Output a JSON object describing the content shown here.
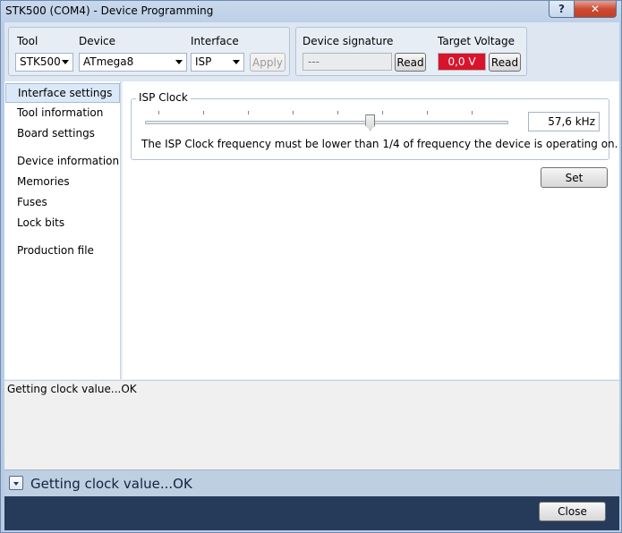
{
  "window": {
    "title": "STK500 (COM4) - Device Programming",
    "help_glyph": "?",
    "close_glyph": "✕"
  },
  "tool_group": {
    "tool_label": "Tool",
    "tool_value": "STK500",
    "device_label": "Device",
    "device_value": "ATmega8",
    "interface_label": "Interface",
    "interface_value": "ISP",
    "apply_label": "Apply"
  },
  "signature_group": {
    "signature_label": "Device signature",
    "signature_value": "---",
    "read_label": "Read",
    "voltage_label": "Target Voltage",
    "voltage_value": "0,0 V",
    "voltage_read_label": "Read",
    "voltage_color": "#d7142b"
  },
  "sidebar": {
    "items": [
      {
        "label": "Interface settings",
        "active": true
      },
      {
        "label": "Tool information"
      },
      {
        "label": "Board settings"
      },
      {
        "label": "Device information"
      },
      {
        "label": "Memories"
      },
      {
        "label": "Fuses"
      },
      {
        "label": "Lock bits"
      },
      {
        "label": "Production file"
      }
    ]
  },
  "isp_clock": {
    "legend": "ISP Clock",
    "frequency": "57,6 kHz",
    "slider_position": 0.62,
    "note": "The ISP Clock frequency must be lower than 1/4 of frequency the device is operating on.",
    "set_label": "Set"
  },
  "log": {
    "lines": [
      "Getting clock value...OK"
    ]
  },
  "status": {
    "text": "Getting clock value...OK"
  },
  "footer": {
    "close_label": "Close"
  }
}
